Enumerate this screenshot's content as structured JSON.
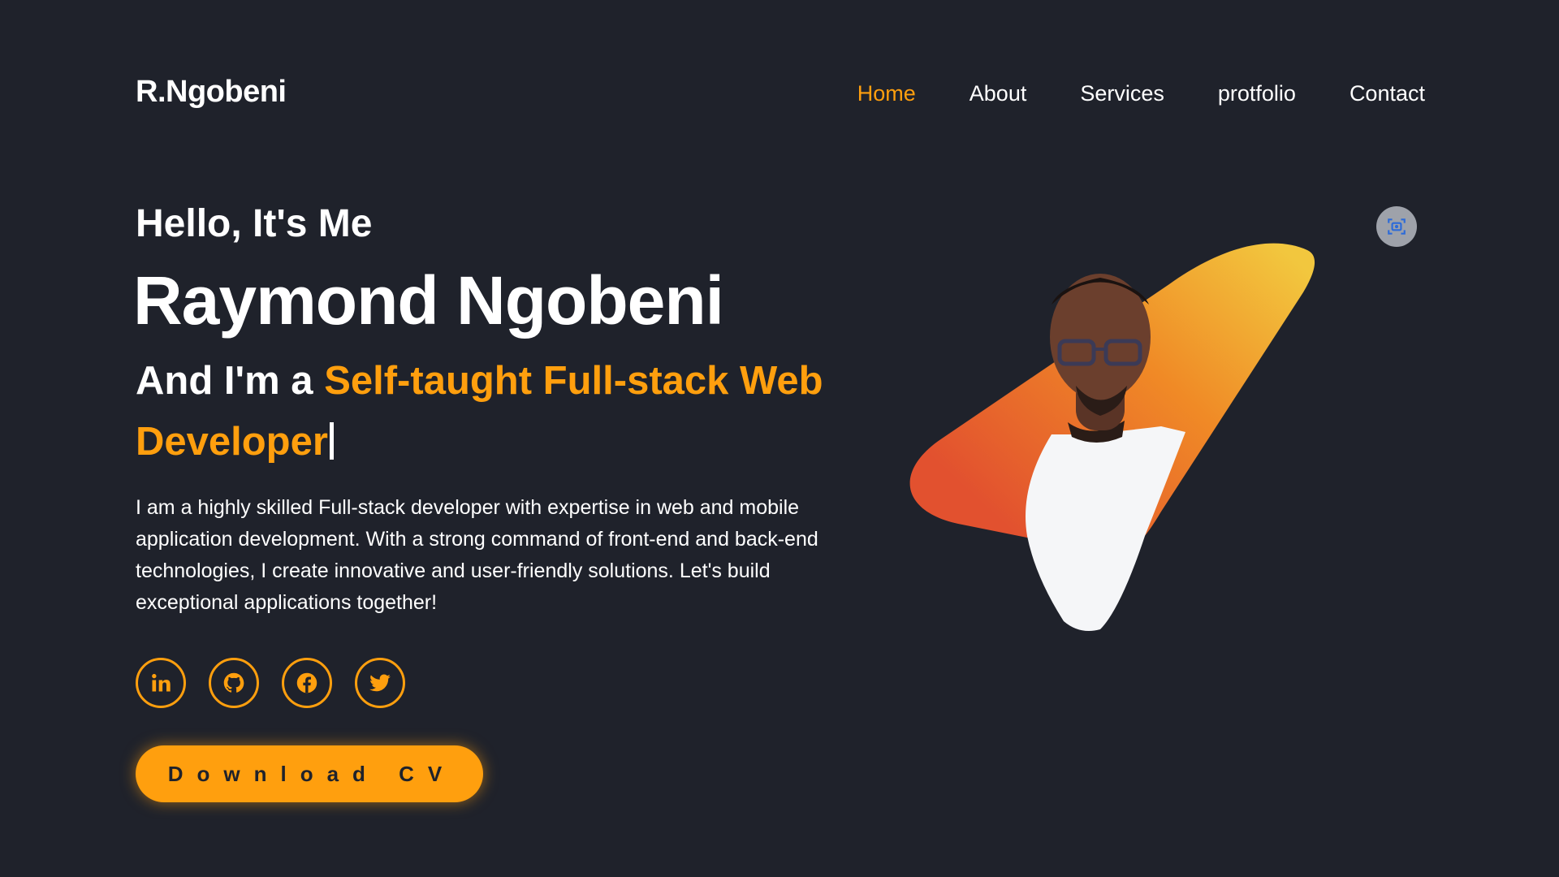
{
  "header": {
    "logo": "R.Ngobeni",
    "nav": [
      {
        "label": "Home",
        "active": true
      },
      {
        "label": "About",
        "active": false
      },
      {
        "label": "Services",
        "active": false
      },
      {
        "label": "protfolio",
        "active": false
      },
      {
        "label": "Contact",
        "active": false
      }
    ]
  },
  "hero": {
    "greeting": "Hello, It's Me",
    "name": "Raymond Ngobeni",
    "role_prefix": "And I'm a ",
    "role_highlight": "Self-taught Full-stack Web Developer",
    "description": "I am a highly skilled Full-stack developer with expertise in web and mobile application development. With a strong command of front-end and back-end technologies, I create innovative and user-friendly solutions. Let's build exceptional applications together!",
    "socials": [
      {
        "icon": "linkedin-icon"
      },
      {
        "icon": "github-icon"
      },
      {
        "icon": "facebook-icon"
      },
      {
        "icon": "twitter-icon"
      }
    ],
    "cv_button": "Download CV",
    "camera_icon": "camera-scan-icon"
  },
  "colors": {
    "background": "#1f222b",
    "accent": "#ff9f0e",
    "text": "#ffffff"
  }
}
